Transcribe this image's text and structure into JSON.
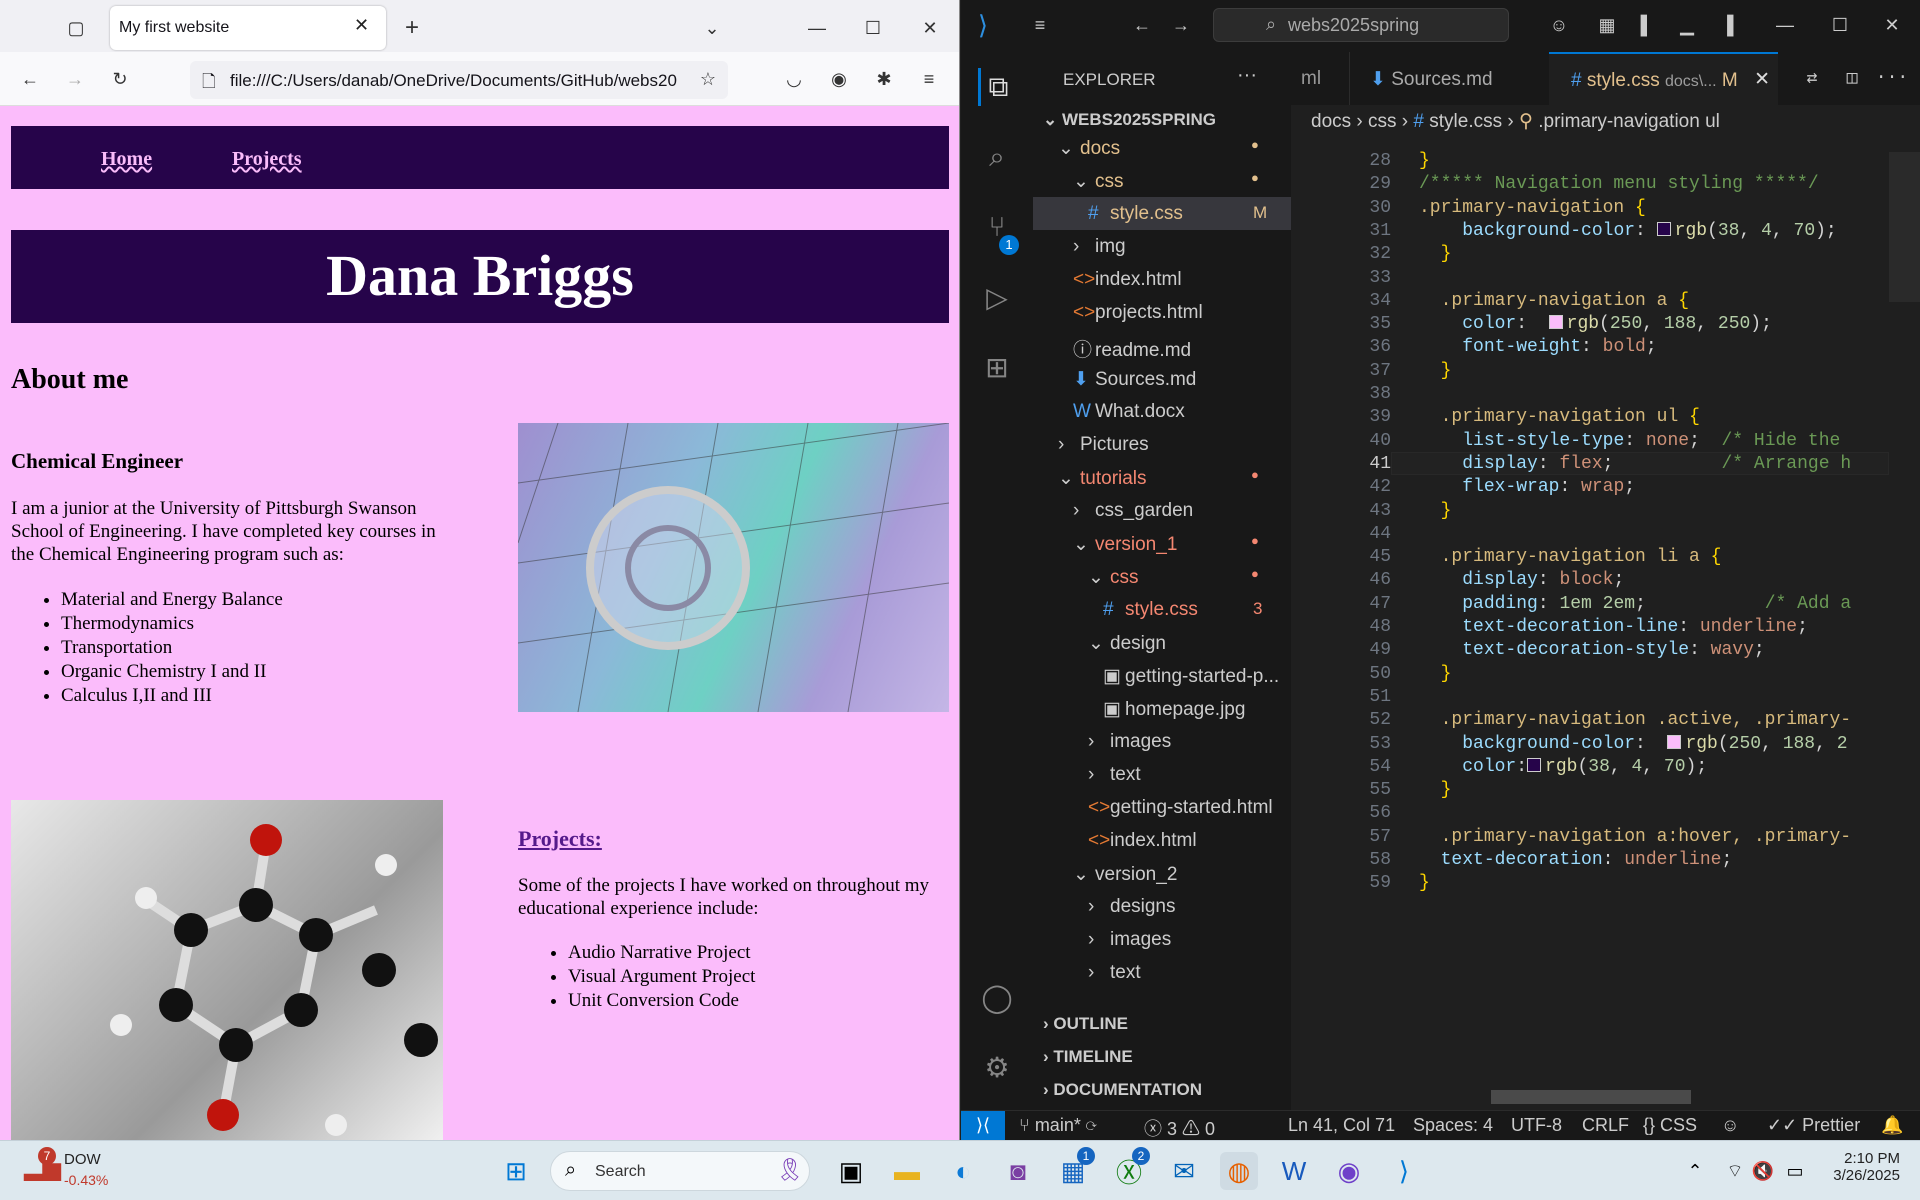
{
  "browser": {
    "tab_title": "My first website",
    "url": "file:///C:/Users/danab/OneDrive/Documents/GitHub/webs20"
  },
  "page": {
    "nav_links": [
      "Home",
      "Projects"
    ],
    "name": "Dana Briggs",
    "about_heading": "About me",
    "subheading": "Chemical Engineer",
    "intro": "I am a junior at the University of Pittsburgh Swanson School of Engineering. I have completed key courses in the Chemical Engineering program such as:",
    "courses": [
      "Material and Energy Balance",
      "Thermodynamics",
      "Transportation",
      "Organic Chemistry I and II",
      "Calculus I,II and III"
    ],
    "projects_heading": "Projects:",
    "projects_intro": "Some of the projects I have worked on throughout my educational experience include:",
    "projects": [
      "Audio Narrative Project",
      "Visual Argument Project",
      "Unit Conversion Code"
    ]
  },
  "vscode": {
    "search": "webs2025spring",
    "explorer_title": "EXPLORER",
    "root": "WEBS2025SPRING",
    "tabs": {
      "partial": "ml",
      "sources": "Sources.md",
      "active": "style.css",
      "active_path": "docs\\...",
      "active_badge": "M"
    },
    "breadcrumb": [
      "docs",
      "css",
      "style.css",
      ".primary-navigation ul"
    ],
    "tree": [
      {
        "label": "docs",
        "indent": 1,
        "chev": "⌄",
        "color": "#e2c08d",
        "badge": "●"
      },
      {
        "label": "css",
        "indent": 2,
        "chev": "⌄",
        "color": "#e2c08d",
        "badge": "●"
      },
      {
        "label": "style.css",
        "indent": 3,
        "icon": "#",
        "color": "#e2c08d",
        "badge": "M",
        "sel": true
      },
      {
        "label": "img",
        "indent": 2,
        "chev": "›",
        "color": "#ccc"
      },
      {
        "label": "index.html",
        "indent": 2,
        "icon": "<>",
        "color": "#ccc"
      },
      {
        "label": "projects.html",
        "indent": 2,
        "icon": "<>",
        "color": "#ccc"
      },
      {
        "label": "readme.md",
        "indent": 2,
        "icon": "ⓘ",
        "color": "#ccc"
      },
      {
        "label": "Sources.md",
        "indent": 2,
        "icon": "⬇",
        "color": "#ccc"
      },
      {
        "label": "What.docx",
        "indent": 2,
        "icon": "W",
        "color": "#ccc"
      },
      {
        "label": "Pictures",
        "indent": 1,
        "chev": "›",
        "color": "#ccc"
      },
      {
        "label": "tutorials",
        "indent": 1,
        "chev": "⌄",
        "color": "#f48771",
        "badge": "●"
      },
      {
        "label": "css_garden",
        "indent": 2,
        "chev": "›",
        "color": "#ccc"
      },
      {
        "label": "version_1",
        "indent": 2,
        "chev": "⌄",
        "color": "#f48771",
        "badge": "●"
      },
      {
        "label": "css",
        "indent": 3,
        "chev": "⌄",
        "color": "#f48771",
        "badge": "●"
      },
      {
        "label": "style.css",
        "indent": 4,
        "icon": "#",
        "color": "#f48771",
        "badge": "3"
      },
      {
        "label": "design",
        "indent": 3,
        "chev": "⌄",
        "color": "#ccc"
      },
      {
        "label": "getting-started-p...",
        "indent": 4,
        "icon": "▣",
        "color": "#ccc"
      },
      {
        "label": "homepage.jpg",
        "indent": 4,
        "icon": "▣",
        "color": "#ccc"
      },
      {
        "label": "images",
        "indent": 3,
        "chev": "›",
        "color": "#ccc"
      },
      {
        "label": "text",
        "indent": 3,
        "chev": "›",
        "color": "#ccc"
      },
      {
        "label": "getting-started.html",
        "indent": 3,
        "icon": "<>",
        "color": "#ccc"
      },
      {
        "label": "index.html",
        "indent": 3,
        "icon": "<>",
        "color": "#ccc"
      },
      {
        "label": "version_2",
        "indent": 2,
        "chev": "⌄",
        "color": "#ccc"
      },
      {
        "label": "designs",
        "indent": 3,
        "chev": "›",
        "color": "#ccc"
      },
      {
        "label": "images",
        "indent": 3,
        "chev": "›",
        "color": "#ccc"
      },
      {
        "label": "text",
        "indent": 3,
        "chev": "›",
        "color": "#ccc"
      }
    ],
    "panels": [
      "OUTLINE",
      "TIMELINE",
      "DOCUMENTATION"
    ],
    "code": [
      {
        "n": 28,
        "h": "<span class='b'>}</span>"
      },
      {
        "n": 29,
        "h": "<span class='c'>/***** Navigation menu styling *****/</span>"
      },
      {
        "n": 30,
        "h": "<span class='k'>.primary-navigation</span> <span class='b'>{</span>"
      },
      {
        "n": 31,
        "h": "    <span class='p'>background-color</span>: <span class='sw' style='background:#26044a'></span><span class='f'>rgb</span>(<span class='n'>38</span>, <span class='n'>4</span>, <span class='n'>70</span>);"
      },
      {
        "n": 32,
        "h": "  <span class='b'>}</span>"
      },
      {
        "n": 33,
        "h": ""
      },
      {
        "n": 34,
        "h": "  <span class='k'>.primary-navigation a</span> <span class='b'>{</span>"
      },
      {
        "n": 35,
        "h": "    <span class='p'>color</span>:  <span class='sw' style='background:#fabcfa'></span><span class='f'>rgb</span>(<span class='n'>250</span>, <span class='n'>188</span>, <span class='n'>250</span>);"
      },
      {
        "n": 36,
        "h": "    <span class='p'>font-weight</span>: <span class='v'>bold</span>;"
      },
      {
        "n": 37,
        "h": "  <span class='b'>}</span>"
      },
      {
        "n": 38,
        "h": ""
      },
      {
        "n": 39,
        "h": "  <span class='k'>.primary-navigation ul</span> <span class='b'>{</span>"
      },
      {
        "n": 40,
        "h": "    <span class='p'>list-style-type</span>: <span class='v'>none</span>;  <span class='c'>/* Hide the</span>"
      },
      {
        "n": 41,
        "h": "    <span class='p'>display</span>: <span class='v'>flex</span>;          <span class='c'>/* Arrange h</span>"
      },
      {
        "n": 42,
        "h": "    <span class='p'>flex-wrap</span>: <span class='v'>wrap</span>;"
      },
      {
        "n": 43,
        "h": "  <span class='b'>}</span>"
      },
      {
        "n": 44,
        "h": ""
      },
      {
        "n": 45,
        "h": "  <span class='k'>.primary-navigation li a</span> <span class='b'>{</span>"
      },
      {
        "n": 46,
        "h": "    <span class='p'>display</span>: <span class='v'>block</span>;"
      },
      {
        "n": 47,
        "h": "    <span class='p'>padding</span>: <span class='n'>1em 2em</span>;           <span class='c'>/* Add a</span>"
      },
      {
        "n": 48,
        "h": "    <span class='p'>text-decoration-line</span>: <span class='v'>underline</span>;"
      },
      {
        "n": 49,
        "h": "    <span class='p'>text-decoration-style</span>: <span class='v'>wavy</span>;"
      },
      {
        "n": 50,
        "h": "  <span class='b'>}</span>"
      },
      {
        "n": 51,
        "h": ""
      },
      {
        "n": 52,
        "h": "  <span class='k'>.primary-navigation .active, .primary-</span>"
      },
      {
        "n": 53,
        "h": "    <span class='p'>background-color</span>:  <span class='sw' style='background:#fabcfa'></span><span class='f'>rgb</span>(<span class='n'>250</span>, <span class='n'>188</span>, <span class='n'>2</span>"
      },
      {
        "n": 54,
        "h": "    <span class='p'>color</span>:<span class='sw' style='background:#26044a'></span><span class='f'>rgb</span>(<span class='n'>38</span>, <span class='n'>4</span>, <span class='n'>70</span>);"
      },
      {
        "n": 55,
        "h": "  <span class='b'>}</span>"
      },
      {
        "n": 56,
        "h": ""
      },
      {
        "n": 57,
        "h": "  <span class='k'>.primary-navigation a:hover, .primary-</span>"
      },
      {
        "n": 58,
        "h": "  <span class='p'>text-decoration</span>: <span class='v'>underline</span>;"
      },
      {
        "n": 59,
        "h": "<span class='b'>}</span>"
      }
    ],
    "status": {
      "branch": "main*",
      "problems": "3",
      "warnings": "0",
      "position": "Ln 41, Col 71",
      "spaces": "Spaces: 4",
      "encoding": "UTF-8",
      "eol": "CRLF",
      "lang": "CSS",
      "formatter": "Prettier",
      "scm_badge": "1"
    }
  },
  "taskbar": {
    "ticker": "DOW",
    "change": "-0.43%",
    "ticker_badge": "7",
    "search": "Search",
    "time": "2:10 PM",
    "date": "3/26/2025",
    "store_badge": "1",
    "xbox_badge": "2"
  }
}
